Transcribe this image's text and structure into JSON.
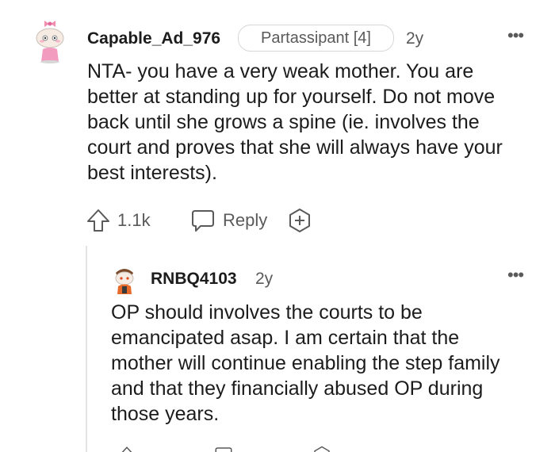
{
  "comment": {
    "username": "Capable_Ad_976",
    "flair": "Partassipant [4]",
    "age": "2y",
    "more_label": "•••",
    "text": "NTA- you have a very weak mother. You are better at standing up for yourself. Do not move back until she grows a spine (ie. involves the court and proves that she will always have your best interests).",
    "upvotes": "1.1k",
    "reply_label": "Reply"
  },
  "reply": {
    "username": "RNBQ4103",
    "age": "2y",
    "more_label": "•••",
    "text": "OP should involves the courts to be emancipated asap. I am certain that the mother will continue enabling the step family and that they financially abused OP during those years."
  },
  "colors": {
    "text": "#1c1c1c",
    "meta": "#5a5a5a",
    "thread_line": "#e3e3e3"
  },
  "icons": [
    "avatar-snoo-pink-bow",
    "upvote-arrow-icon",
    "reply-bubble-icon",
    "add-award-icon",
    "avatar-snoo-orange",
    "more-options-icon"
  ]
}
